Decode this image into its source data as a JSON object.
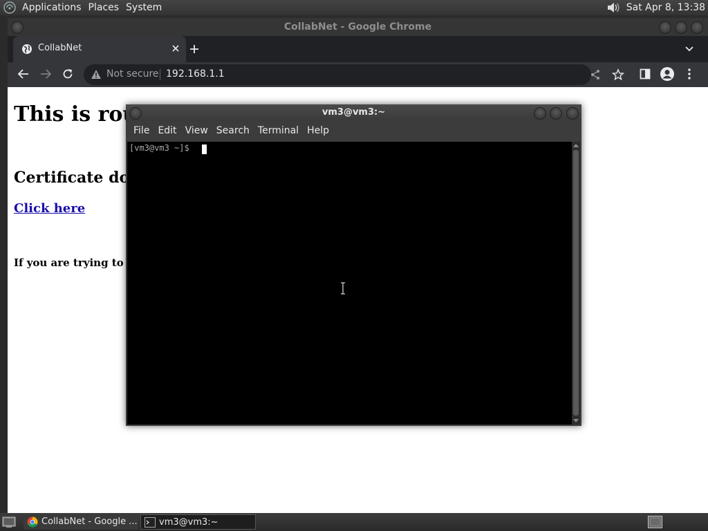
{
  "top_panel": {
    "menus": [
      "Applications",
      "Places",
      "System"
    ],
    "clock": "Sat Apr  8, 13:38",
    "icons": {
      "distro": "distro-logo-icon",
      "volume": "volume-icon"
    }
  },
  "chrome": {
    "window_title": "CollabNet - Google Chrome",
    "tab": {
      "title": "CollabNet",
      "favicon": "globe-icon"
    },
    "security_label": "Not secure",
    "url": "192.168.1.1",
    "page": {
      "heading1": "This is route",
      "heading2": "Certificate down",
      "link_text": "Click here",
      "note": "If you are trying to insta"
    }
  },
  "terminal": {
    "title": "vm3@vm3:~",
    "menus": [
      "File",
      "Edit",
      "View",
      "Search",
      "Terminal",
      "Help"
    ],
    "prompt": "[vm3@vm3 ~]$ "
  },
  "taskbar": {
    "items": [
      {
        "label": "CollabNet - Google ...",
        "icon": "chrome-icon",
        "active": false
      },
      {
        "label": "vm3@vm3:~",
        "icon": "terminal-icon",
        "active": true
      }
    ]
  },
  "colors": {
    "panel_bg": "#333333",
    "chrome_dark": "#35363a",
    "terminal_bg": "#000000",
    "link": "#1a0dab"
  }
}
